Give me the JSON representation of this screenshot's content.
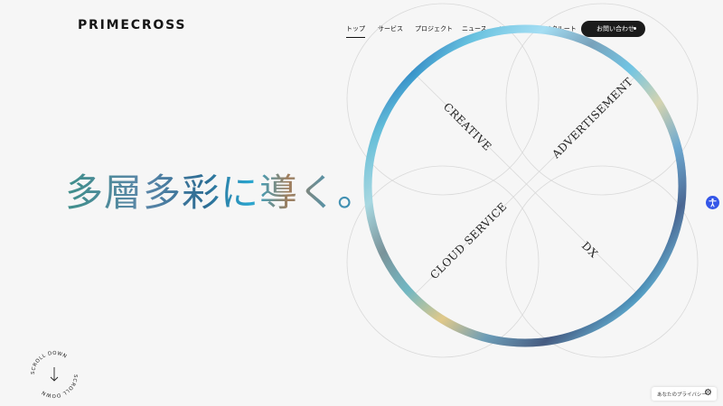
{
  "header": {
    "logo": "PRIMECROSS",
    "nav": [
      {
        "label": "トップ",
        "active": true
      },
      {
        "label": "サービス"
      },
      {
        "label": "プロジェクト"
      },
      {
        "label": "ニュース"
      },
      {
        "label": "コーポレート"
      },
      {
        "label": "リクルート"
      }
    ],
    "contact_label": "お問い合わせ"
  },
  "hero": {
    "headline": "多層多彩に導く。"
  },
  "diagram": {
    "labels": [
      "CREATIVE",
      "ADVERTISEMENT",
      "CLOUD SERVICE",
      "DX"
    ]
  },
  "scroll": {
    "label": "SCROLL DOWN"
  },
  "privacy": {
    "label": "あなたのプライバシー"
  },
  "icons": {
    "accessibility": "accessibility-icon",
    "privacy": "gear-icon",
    "scroll": "arrow-down-icon"
  },
  "colors": {
    "accessibility_button": "#3557e8",
    "contact_button": "#1b1b1b"
  }
}
